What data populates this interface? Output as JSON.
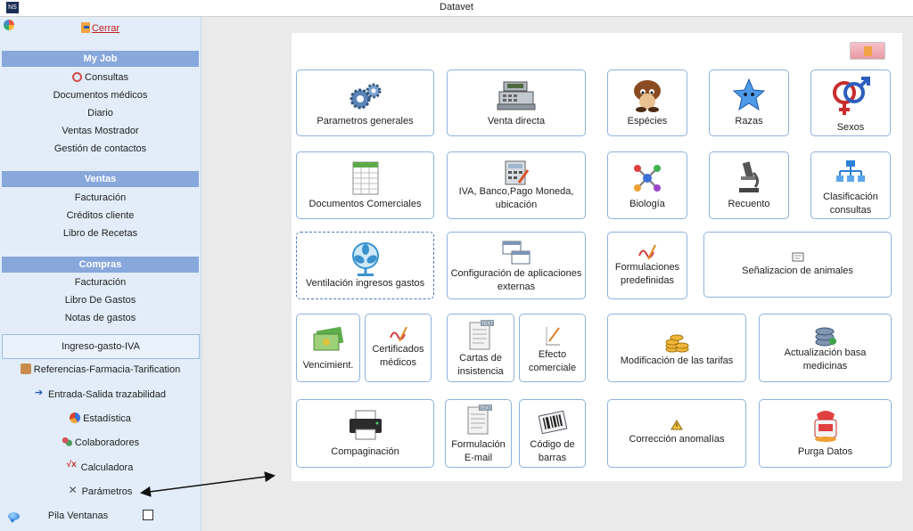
{
  "window": {
    "title": "Datavet",
    "app_icon": "NS"
  },
  "sidebar": {
    "close_label": "Cerrar",
    "sections": [
      {
        "title": "My Job",
        "items": [
          "Consultas",
          "Documentos médicos",
          "Diario",
          "Ventas Mostrador",
          "Gestión de contactos"
        ]
      },
      {
        "title": "Ventas",
        "items": [
          "Facturación",
          "Créditos cliente",
          "Libro de Recetas"
        ]
      },
      {
        "title": "Compras",
        "items": [
          "Facturación",
          "Libro De Gastos",
          "Notas de gastos"
        ]
      }
    ],
    "boxed_item": "Ingreso-gasto-IVA",
    "extra_items": [
      "Referencias-Farmacia-Tarification",
      "Entrada-Salida trazabilidad",
      "Estadística",
      "Colaboradores",
      "Calculadora",
      "Parámetros"
    ],
    "stack_label": "Pila Ventanas",
    "stack_checked": false
  },
  "tiles": [
    {
      "key": "parametros_generales",
      "label": "Parametros generales",
      "icon": "gears-icon"
    },
    {
      "key": "venta_directa",
      "label": "Venta directa",
      "icon": "cash-register-icon"
    },
    {
      "key": "especies",
      "label": "Espécies",
      "icon": "mushroom-icon"
    },
    {
      "key": "razas",
      "label": "Razas",
      "icon": "star-creature-icon"
    },
    {
      "key": "sexos",
      "label": "Sexos",
      "icon": "gender-icon"
    },
    {
      "key": "documentos_comerciales",
      "label": "Documentos Comerciales",
      "icon": "spreadsheet-icon"
    },
    {
      "key": "iva_banco",
      "label": "IVA, Banco,Pago Moneda, ubicación",
      "icon": "calculator-pen-icon"
    },
    {
      "key": "biologia",
      "label": "Biología",
      "icon": "molecule-icon"
    },
    {
      "key": "recuento",
      "label": "Recuento",
      "icon": "microscope-icon"
    },
    {
      "key": "clasificacion_consultas",
      "label": "Clasificación consultas",
      "icon": "hierarchy-icon"
    },
    {
      "key": "ventilacion",
      "label": "Ventilación ingresos gastos",
      "icon": "fan-icon"
    },
    {
      "key": "configuracion",
      "label": "Configuración de aplicaciones externas",
      "icon": "windows-icon"
    },
    {
      "key": "formulaciones",
      "label": "Formulaciones predefinidas",
      "icon": "signature-icon"
    },
    {
      "key": "senalizacion",
      "label": "Señalizacion de animales",
      "icon": "tag-card-icon"
    },
    {
      "key": "vencimiento",
      "label": "Vencimient.",
      "icon": "banknotes-icon"
    },
    {
      "key": "certificados",
      "label": "Certificados médicos",
      "icon": "signature-icon"
    },
    {
      "key": "cartas",
      "label": "Cartas de insistencia",
      "icon": "text-document-icon"
    },
    {
      "key": "efecto",
      "label": "Efecto comerciale",
      "icon": "pen-document-icon"
    },
    {
      "key": "modificacion_tarifas",
      "label": "Modificación de las tarifas",
      "icon": "coins-icon"
    },
    {
      "key": "actualizacion",
      "label": "Actualización basa medicinas",
      "icon": "database-icon"
    },
    {
      "key": "compaginacion",
      "label": "Compaginación",
      "icon": "printer-icon"
    },
    {
      "key": "formulacion_email",
      "label": "Formulación E-mail",
      "icon": "text-document-icon"
    },
    {
      "key": "codigo_barras",
      "label": "Código de barras",
      "icon": "barcode-icon"
    },
    {
      "key": "correccion",
      "label": "Corrección anomalías",
      "icon": "warning-icon"
    },
    {
      "key": "purga",
      "label": "Purga Datos",
      "icon": "cleaner-icon"
    }
  ]
}
